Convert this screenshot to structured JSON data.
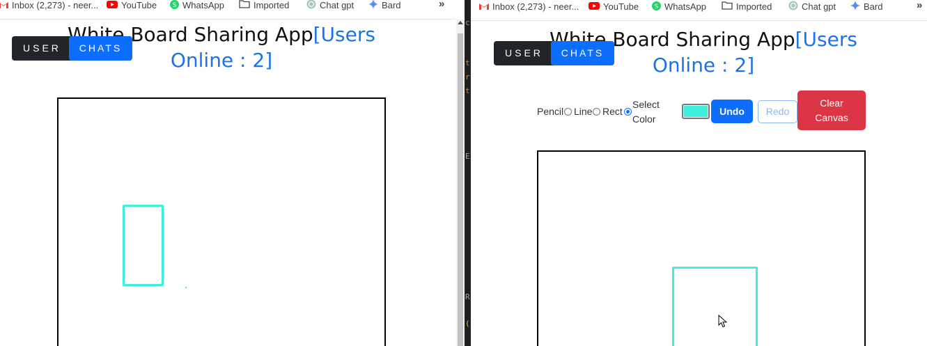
{
  "bookmarks": [
    {
      "label": "Inbox (2,273) - neer...",
      "icon": "gmail-icon"
    },
    {
      "label": "YouTube",
      "icon": "youtube-icon"
    },
    {
      "label": "WhatsApp",
      "icon": "whatsapp-icon"
    },
    {
      "label": "Imported",
      "icon": "folder-icon"
    },
    {
      "label": "Chat gpt",
      "icon": "chatgpt-icon"
    },
    {
      "label": "Bard",
      "icon": "bard-icon"
    }
  ],
  "more_label": "»",
  "app": {
    "title": "White Board Sharing App",
    "users_online": "[Users Online : 2]",
    "users_online_line1": "[Users",
    "users_online_line2": "Online : 2]"
  },
  "tabs": {
    "user": "USER",
    "chats": "CHATS"
  },
  "toolbar": {
    "pencil": "Pencil",
    "line": "Line",
    "rect": "Rect",
    "selected_tool": "rect",
    "select_color_line1": "Select",
    "select_color_line2": "Color",
    "color": "#3ef0dc",
    "undo": "Undo",
    "redo": "Redo",
    "clear_line1": "Clear",
    "clear_line2": "Canvas"
  },
  "colors": {
    "accent_blue": "#0d6efd",
    "title_blue": "#1a73e8",
    "danger": "#dc3545",
    "dark": "#212529",
    "stroke": "#3ef0dc"
  }
}
